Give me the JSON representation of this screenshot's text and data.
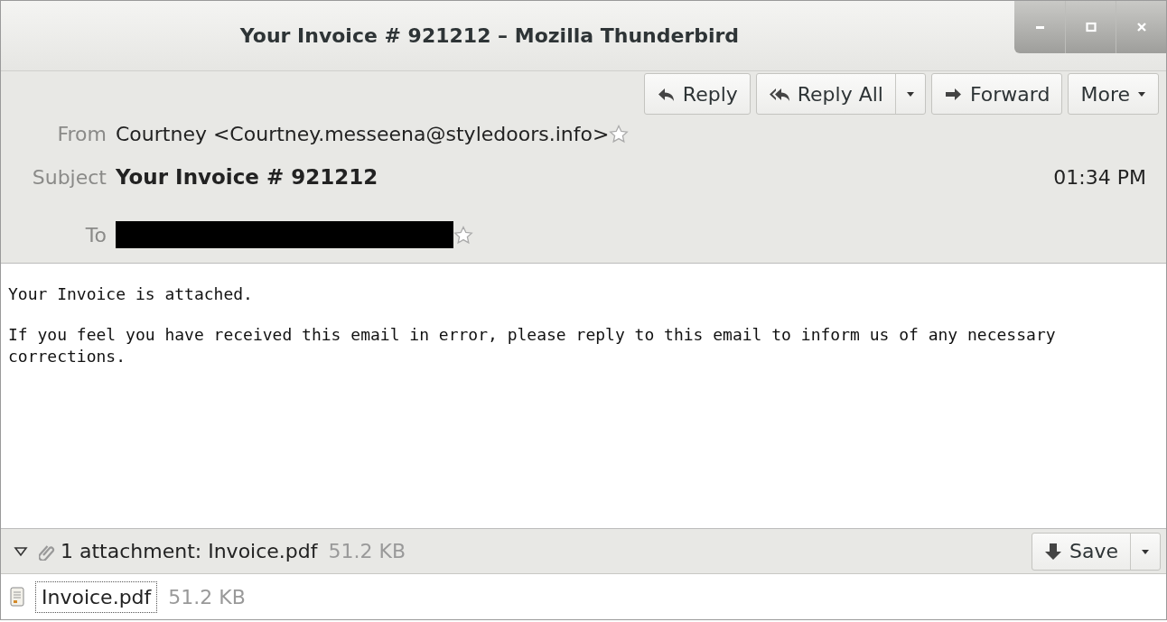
{
  "window": {
    "title": "Your Invoice # 921212 – Mozilla Thunderbird"
  },
  "toolbar": {
    "buttons": [
      {
        "label": "Reply",
        "kind": "reply"
      },
      {
        "label": "Reply All",
        "kind": "replyall"
      },
      {
        "label": "Forward",
        "kind": "forward"
      },
      {
        "label": "More",
        "kind": "more"
      }
    ]
  },
  "header": {
    "from": {
      "label": "From",
      "value": "Courtney <Courtney.messeena@styledoors.info>",
      "starred": false
    },
    "subject": {
      "label": "Subject",
      "value": "Your Invoice # 921212"
    },
    "date": "01:34 PM",
    "to": {
      "label": "To",
      "redacted": true,
      "starred": false
    }
  },
  "body": [
    "Your Invoice is attached.",
    "If you feel you have received this email in error, please reply to this email to inform us of any necessary corrections."
  ],
  "attachment_bar": {
    "expanded": true,
    "summary": "1 attachment: Invoice.pdf",
    "size": "51.2 KB",
    "save_label": "Save"
  },
  "attachments": [
    {
      "name": "Invoice.pdf",
      "size": "51.2 KB",
      "selected": true
    }
  ]
}
